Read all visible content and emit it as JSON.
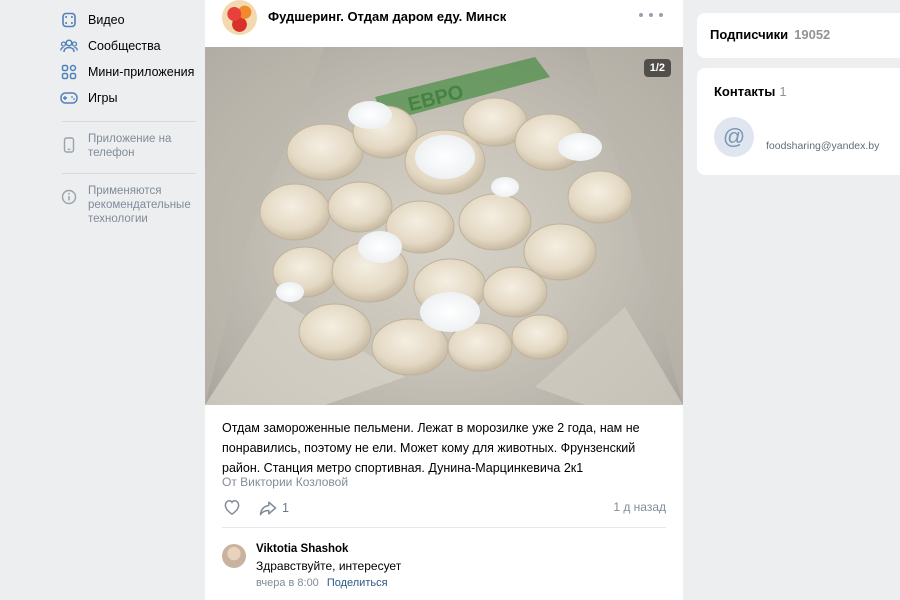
{
  "sidebar": {
    "items": [
      {
        "icon": "video-icon",
        "label": "Видео"
      },
      {
        "icon": "communities-icon",
        "label": "Сообщества"
      },
      {
        "icon": "mini-apps-icon",
        "label": "Мини-приложения"
      },
      {
        "icon": "games-icon",
        "label": "Игры"
      }
    ],
    "app_promo": {
      "icon": "phone-icon",
      "label": "Приложение на телефон"
    },
    "recommendations_note": {
      "icon": "info-icon",
      "label": "Применяются рекомендательные технологии"
    }
  },
  "post": {
    "group_name": "Фудшеринг. Отдам даром еду. Минск",
    "photo_counter": "1/2",
    "text": "Отдам замороженные пельмени. Лежат в морозилке уже 2 года, нам не понравились, поэтому не ели. Может кому для животных. Фрунзенский район. Станция метро спортивная. Дунина-Марцинкевича 2к1",
    "author": "От Виктории Козловой",
    "share_count": "1",
    "time": "1 д назад",
    "comment": {
      "name": "Viktotia Shashok",
      "text": "Здравствуйте, интересует",
      "time": "вчера в 8:00",
      "share_label": "Поделиться"
    }
  },
  "right": {
    "subscribers_label": "Подписчики",
    "subscribers_count": "19052",
    "contacts_label": "Контакты",
    "contacts_count": "1",
    "contact_email": "foodsharing@yandex.by"
  },
  "colors": {
    "accent": "#2a5885",
    "muted": "#818c99",
    "icon": "#5181b8"
  }
}
